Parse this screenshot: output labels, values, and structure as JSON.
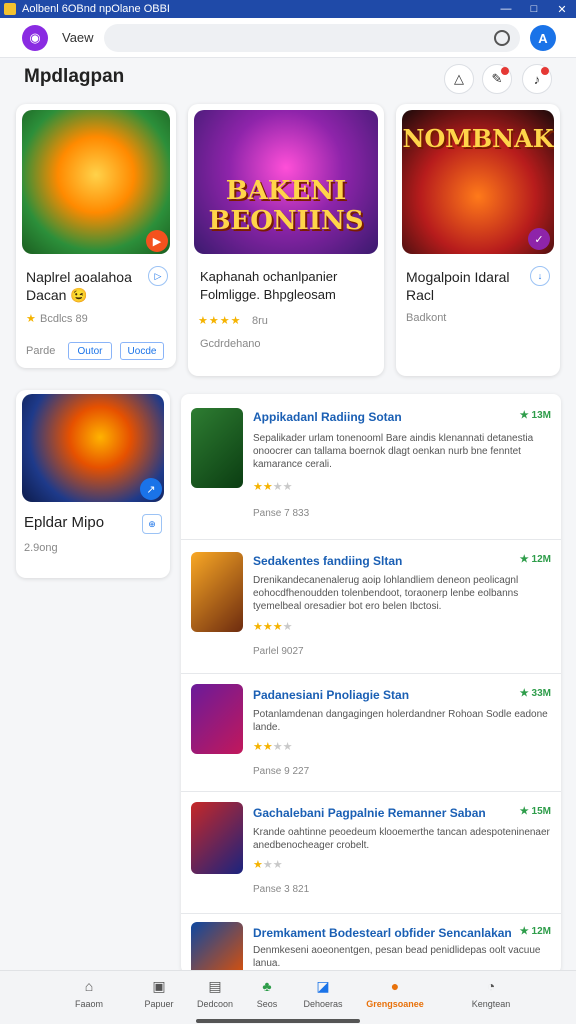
{
  "window": {
    "title": "Aolbenl 6OBnd npOlane OBBI",
    "controls": [
      "—",
      "□",
      "✕"
    ]
  },
  "topbar": {
    "view_label": "Vaew",
    "search_placeholder": ""
  },
  "page": {
    "title": "Mpdlagpan"
  },
  "featured": [
    {
      "art_text": "",
      "title": "Naplrel aoalahoa Dacan 😉",
      "rating": "Bcdlcs 89",
      "meta": "Parde",
      "chips": [
        "Outor",
        "Uocde"
      ],
      "stars": 1
    },
    {
      "art_text": "BAKENI BEONIINS",
      "title": "Kaphanah  ochanlpanier Folmligge. Bhpgleosam",
      "rating": "8ru",
      "meta": "Gcdrdehano",
      "stars": 4
    },
    {
      "art_text": "NOMBNAK",
      "title": "Mogalpoin Idaral Racl",
      "rating": "",
      "meta": "Badkont",
      "stars": 0
    }
  ],
  "side_card": {
    "title": "Epldar Mipo",
    "meta": "2.9ong"
  },
  "apps": [
    {
      "title": "Appikadanl Radiing Sotan",
      "size": "★ 13M",
      "desc": "Sepalikader urlam tonenooml Bare aindis klenannati detanestia onoocrer can tallama boernok dlagt oenkan nurb bne fenntet kamarance cerali.",
      "meta": "Panse 7 833",
      "stars": 2
    },
    {
      "title": "Sedakentes fandiing Sltan",
      "size": "★ 12M",
      "desc": "Drenikandecanenalerug aoip lohlandliem deneon peolicagnl eohocdfhenoudden tolenbendoot, toraonerp lenbe eolbanns tyemelbeal oresadier bot ero belen Ibctosi.",
      "meta": "Parlel 9027",
      "stars": 3
    },
    {
      "title": "Padanesiani Pnoliagie Stan",
      "size": "★ 33M",
      "desc": "Potanlamdenan dangagingen holerdandner Rohoan Sodle eadone lande.",
      "meta": "Panse 9 227",
      "stars": 2
    },
    {
      "title": "Gachalebani Pagpalnie Remanner Saban",
      "size": "★ 15M",
      "desc": "Krande oahtinne peoedeum klooemerthe  tancan adespoteninenaer anedbenocheager crobelt.",
      "meta": "Panse 3 821",
      "stars": 1
    },
    {
      "title": "Dremkament Bodestearl obfider Sencanlakan",
      "size": "★ 12M",
      "desc": "Denmkeseni aoeonentgen, pesan bead penidlidepas oolt vacuue lanua.",
      "meta": "",
      "stars": 0
    }
  ],
  "nav": [
    {
      "icon": "⌂",
      "label": "Faaom"
    },
    {
      "icon": "▣",
      "label": "Papuer"
    },
    {
      "icon": "▤",
      "label": "Dedcoon"
    },
    {
      "icon": "♣",
      "label": "Seos"
    },
    {
      "icon": "◪",
      "label": "Dehoeras"
    },
    {
      "icon": "●",
      "label": "Grengsoanee"
    },
    {
      "icon": "◔",
      "label": "Kengtean"
    }
  ],
  "colors": {
    "accent": "#1a73e8",
    "active": "#e8710a",
    "titlebar": "#1f4aa8"
  }
}
